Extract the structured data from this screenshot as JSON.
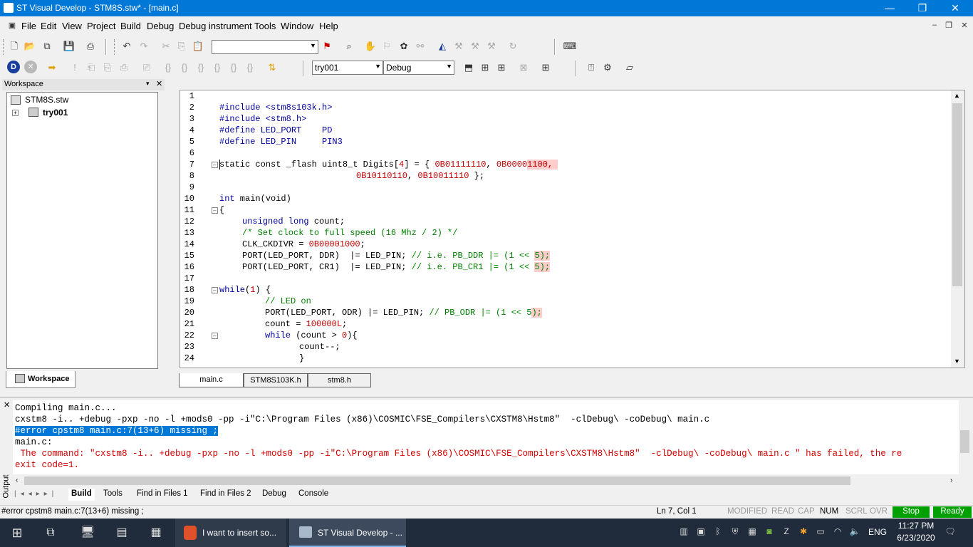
{
  "window": {
    "title": "ST Visual Develop - STM8S.stw* - [main.c]",
    "minimize": "—",
    "restore": "❐",
    "close": "✕"
  },
  "menu": {
    "items": [
      "File",
      "Edit",
      "View",
      "Project",
      "Build",
      "Debug",
      "Debug instrument",
      "Tools",
      "Window",
      "Help"
    ]
  },
  "toolbar": {
    "find_combo_value": "",
    "project_combo_value": "try001",
    "config_combo_value": "Debug"
  },
  "workspace": {
    "header": "Workspace",
    "root": "STM8S.stw",
    "project": "try001",
    "tab_label": "Workspace"
  },
  "editor": {
    "line_numbers": [
      "1",
      "2",
      "3",
      "4",
      "5",
      "6",
      "7",
      "8",
      "9",
      "10",
      "11",
      "12",
      "13",
      "14",
      "15",
      "16",
      "17",
      "18",
      "19",
      "20",
      "21",
      "22",
      "23",
      "24"
    ],
    "tabs": [
      "main.c",
      "STM8S103K.h",
      "stm8.h"
    ],
    "lines": {
      "l2": "#include <stm8s103k.h>",
      "l3": "#include <stm8.h>",
      "l4": "#define LED_PORT    PD",
      "l5": "#define LED_PIN     PIN3",
      "l7a": "static const _flash uint8_t Digits[",
      "l7b": "4",
      "l7c": "] = { ",
      "l7d": "0B01111110",
      "l7e": ", ",
      "l7f": "0B0000",
      "l7g": "1100,",
      "l8a": "0B10110110",
      "l8b": ", ",
      "l8c": "0B10011110",
      "l8d": " };",
      "l10a": "int",
      "l10b": " main(void)",
      "l11": "{",
      "l12a": "unsigned long",
      "l12b": " count;",
      "l13": "/* Set clock to full speed (16 Mhz / 2) */",
      "l14a": "CLK_CKDIVR = ",
      "l14b": "0B00001000",
      "l14c": ";",
      "l15a": "PORT(LED_PORT, DDR)  |= LED_PIN; ",
      "l15b": "// i.e. PB_DDR |= (1 << ",
      "l15c": "5);",
      "l16a": "PORT(LED_PORT, CR1)  |= LED_PIN; ",
      "l16b": "// i.e. PB_CR1 |= (1 << ",
      "l16c": "5);",
      "l18a": "while",
      "l18b": "(",
      "l18c": "1",
      "l18d": ") {",
      "l19": "// LED on",
      "l20a": "PORT(LED_PORT, ODR) |= LED_PIN; ",
      "l20b": "// PB_ODR |= (1 << 5",
      "l20c": ");",
      "l21a": "count = ",
      "l21b": "100000L",
      "l21c": ";",
      "l22a": "while",
      "l22b": " (count > ",
      "l22c": "0",
      "l22d": "){",
      "l23": "count--;",
      "l24": "}"
    }
  },
  "output": {
    "side_label": "Output",
    "line1": "Compiling main.c...",
    "line2": "cxstm8 -i.. +debug -pxp -no -l +mods0 -pp -i\"C:\\Program Files (x86)\\COSMIC\\FSE_Compilers\\CXSTM8\\Hstm8\"  -clDebug\\ -coDebug\\ main.c",
    "line3": "#error cpstm8 main.c:7(13+6) missing ;",
    "line4": "main.c:",
    "line5": " The command: \"cxstm8 -i.. +debug -pxp -no -l +mods0 -pp -i\"C:\\Program Files (x86)\\COSMIC\\FSE_Compilers\\CXSTM8\\Hstm8\"  -clDebug\\ -coDebug\\ main.c \" has failed, the re",
    "line6": "exit code=1.",
    "tabs": [
      "Build",
      "Tools",
      "Find in Files 1",
      "Find in Files 2",
      "Debug",
      "Console"
    ]
  },
  "status": {
    "message": "#error cpstm8 main.c:7(13+6) missing ;",
    "position": "Ln 7, Col 1",
    "modified": "MODIFIED",
    "read": "READ",
    "cap": "CAP",
    "num": "NUM",
    "scrl": "SCRL",
    "ovr": "OVR",
    "stop": "Stop",
    "ready": "Ready"
  },
  "taskbar": {
    "app1": "I want to insert so...",
    "app2": "ST Visual Develop - ...",
    "lang": "ENG",
    "time": "11:27 PM",
    "date": "6/23/2020"
  },
  "colors": {
    "titlebar": "#0078d7",
    "taskbar": "#202b3b",
    "status_green": "#00a000",
    "error_red": "#d40000",
    "keyword_blue": "#0000a0",
    "comment_green": "#008000"
  }
}
